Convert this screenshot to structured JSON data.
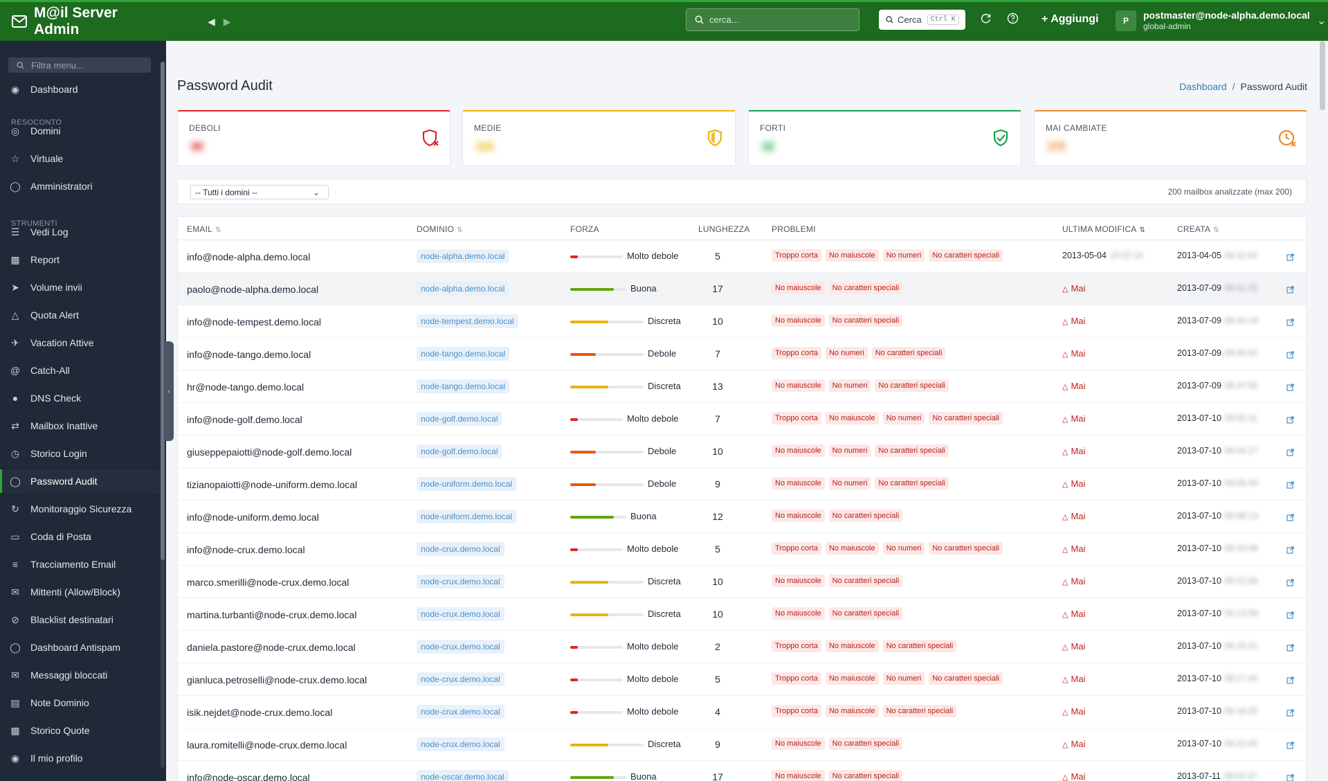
{
  "app": {
    "title": "M@il Server Admin"
  },
  "topbar": {
    "search_placeholder": "cerca...",
    "cmdk_label": "Cerca",
    "cmdk_kbd": "Ctrl K",
    "add_label": "+ Aggiungi",
    "user_initial": "P",
    "user_email": "postmaster@node-alpha.demo.local",
    "user_role": "global-admin"
  },
  "sidebar": {
    "filter_placeholder": "Filtra menu...",
    "section_resoconto": "RESOCONTO",
    "section_strumenti": "STRUMENTI",
    "items": [
      {
        "label": "Dashboard",
        "icon": "dashboard-icon"
      },
      {
        "label": "Domini",
        "icon": "globe-icon"
      },
      {
        "label": "Virtuale",
        "icon": "users-icon"
      },
      {
        "label": "Amministratori",
        "icon": "shield-icon"
      },
      {
        "label": "Vedi Log",
        "icon": "list-icon"
      },
      {
        "label": "Report",
        "icon": "chart-icon"
      },
      {
        "label": "Volume invii",
        "icon": "send-icon"
      },
      {
        "label": "Quota Alert",
        "icon": "warning-icon"
      },
      {
        "label": "Vacation Attive",
        "icon": "plane-icon"
      },
      {
        "label": "Catch-All",
        "icon": "at-icon"
      },
      {
        "label": "DNS Check",
        "icon": "user-icon"
      },
      {
        "label": "Mailbox Inattive",
        "icon": "swap-icon"
      },
      {
        "label": "Storico Login",
        "icon": "history-icon"
      },
      {
        "label": "Password Audit",
        "icon": "shield-check-icon",
        "active": true
      },
      {
        "label": "Monitoraggio Sicurezza",
        "icon": "refresh-icon"
      },
      {
        "label": "Coda di Posta",
        "icon": "inbox-icon"
      },
      {
        "label": "Tracciamento Email",
        "icon": "filter-icon"
      },
      {
        "label": "Mittenti (Allow/Block)",
        "icon": "mail-icon"
      },
      {
        "label": "Blacklist destinatari",
        "icon": "ban-icon"
      },
      {
        "label": "Dashboard Antispam",
        "icon": "shield-icon"
      },
      {
        "label": "Messaggi bloccati",
        "icon": "blocked-mail-icon"
      },
      {
        "label": "Note Dominio",
        "icon": "note-icon"
      },
      {
        "label": "Storico Quote",
        "icon": "chart-icon"
      },
      {
        "label": "Il mio profilo",
        "icon": "user-circle-icon"
      }
    ]
  },
  "page": {
    "title": "Password Audit",
    "breadcrumb_home": "Dashboard",
    "breadcrumb_current": "Password Audit"
  },
  "stats": [
    {
      "label": "DEBOLI",
      "value": "96",
      "color": "#dc2626"
    },
    {
      "label": "MEDIE",
      "value": "122",
      "color": "#eab308"
    },
    {
      "label": "FORTI",
      "value": "12",
      "color": "#16a34a"
    },
    {
      "label": "MAI CAMBIATE",
      "value": "173",
      "color": "#ea8a2e"
    }
  ],
  "filter": {
    "domain_selected": "-- Tutti i domini --",
    "info": "200 mailbox analizzate (max 200)"
  },
  "table": {
    "headers": {
      "email": "EMAIL",
      "domain": "DOMINIO",
      "strength": "FORZA",
      "length": "LUNGHEZZA",
      "problems": "PROBLEMI",
      "modified": "ULTIMA MODIFICA",
      "created": "CREATA"
    },
    "rows": [
      {
        "email": "info@node-alpha.demo.local",
        "domain": "node-alpha.demo.local",
        "strength": "Molto debole",
        "level": 0.1,
        "length": "5",
        "problems": [
          "Troppo corta",
          "No maiuscole",
          "No numeri",
          "No caratteri speciali"
        ],
        "modified": "2013-05-04",
        "modified_time": "10:22:14",
        "created": "2013-04-05",
        "created_time": "09:11:02"
      },
      {
        "email": "paolo@node-alpha.demo.local",
        "domain": "node-alpha.demo.local",
        "strength": "Buona",
        "level": 0.78,
        "length": "17",
        "problems": [
          "No maiuscole",
          "No caratteri speciali"
        ],
        "modified": "Mai",
        "created": "2013-07-09",
        "created_time": "08:41:33"
      },
      {
        "email": "info@node-tempest.demo.local",
        "domain": "node-tempest.demo.local",
        "strength": "Discreta",
        "level": 0.52,
        "length": "10",
        "problems": [
          "No maiuscole",
          "No caratteri speciali"
        ],
        "modified": "Mai",
        "created": "2013-07-09",
        "created_time": "08:43:19"
      },
      {
        "email": "info@node-tango.demo.local",
        "domain": "node-tango.demo.local",
        "strength": "Debole",
        "level": 0.35,
        "length": "7",
        "problems": [
          "Troppo corta",
          "No numeri",
          "No caratteri speciali"
        ],
        "modified": "Mai",
        "created": "2013-07-09",
        "created_time": "08:45:02"
      },
      {
        "email": "hr@node-tango.demo.local",
        "domain": "node-tango.demo.local",
        "strength": "Discreta",
        "level": 0.52,
        "length": "13",
        "problems": [
          "No maiuscole",
          "No numeri",
          "No caratteri speciali"
        ],
        "modified": "Mai",
        "created": "2013-07-09",
        "created_time": "08:47:55"
      },
      {
        "email": "info@node-golf.demo.local",
        "domain": "node-golf.demo.local",
        "strength": "Molto debole",
        "level": 0.1,
        "length": "7",
        "problems": [
          "Troppo corta",
          "No maiuscole",
          "No numeri",
          "No caratteri speciali"
        ],
        "modified": "Mai",
        "created": "2013-07-10",
        "created_time": "09:02:11"
      },
      {
        "email": "giuseppepaiotti@node-golf.demo.local",
        "domain": "node-golf.demo.local",
        "strength": "Debole",
        "level": 0.35,
        "length": "10",
        "problems": [
          "No maiuscole",
          "No numeri",
          "No caratteri speciali"
        ],
        "modified": "Mai",
        "created": "2013-07-10",
        "created_time": "09:04:27"
      },
      {
        "email": "tizianopaiotti@node-uniform.demo.local",
        "domain": "node-uniform.demo.local",
        "strength": "Debole",
        "level": 0.35,
        "length": "9",
        "problems": [
          "No maiuscole",
          "No numeri",
          "No caratteri speciali"
        ],
        "modified": "Mai",
        "created": "2013-07-10",
        "created_time": "09:06:40"
      },
      {
        "email": "info@node-uniform.demo.local",
        "domain": "node-uniform.demo.local",
        "strength": "Buona",
        "level": 0.78,
        "length": "12",
        "problems": [
          "No maiuscole",
          "No caratteri speciali"
        ],
        "modified": "Mai",
        "created": "2013-07-10",
        "created_time": "09:08:13"
      },
      {
        "email": "info@node-crux.demo.local",
        "domain": "node-crux.demo.local",
        "strength": "Molto debole",
        "level": 0.1,
        "length": "5",
        "problems": [
          "Troppo corta",
          "No maiuscole",
          "No numeri",
          "No caratteri speciali"
        ],
        "modified": "Mai",
        "created": "2013-07-10",
        "created_time": "09:10:48"
      },
      {
        "email": "marco.smerilli@node-crux.demo.local",
        "domain": "node-crux.demo.local",
        "strength": "Discreta",
        "level": 0.52,
        "length": "10",
        "problems": [
          "No maiuscole",
          "No caratteri speciali"
        ],
        "modified": "Mai",
        "created": "2013-07-10",
        "created_time": "09:12:06"
      },
      {
        "email": "martina.turbanti@node-crux.demo.local",
        "domain": "node-crux.demo.local",
        "strength": "Discreta",
        "level": 0.52,
        "length": "10",
        "problems": [
          "No maiuscole",
          "No caratteri speciali"
        ],
        "modified": "Mai",
        "created": "2013-07-10",
        "created_time": "09:13:59"
      },
      {
        "email": "daniela.pastore@node-crux.demo.local",
        "domain": "node-crux.demo.local",
        "strength": "Molto debole",
        "level": 0.1,
        "length": "2",
        "problems": [
          "Troppo corta",
          "No maiuscole",
          "No caratteri speciali"
        ],
        "modified": "Mai",
        "created": "2013-07-10",
        "created_time": "09:15:31"
      },
      {
        "email": "gianluca.petroselli@node-crux.demo.local",
        "domain": "node-crux.demo.local",
        "strength": "Molto debole",
        "level": 0.1,
        "length": "5",
        "problems": [
          "Troppo corta",
          "No maiuscole",
          "No numeri",
          "No caratteri speciali"
        ],
        "modified": "Mai",
        "created": "2013-07-10",
        "created_time": "09:17:44"
      },
      {
        "email": "isik.nejdet@node-crux.demo.local",
        "domain": "node-crux.demo.local",
        "strength": "Molto debole",
        "level": 0.1,
        "length": "4",
        "problems": [
          "Troppo corta",
          "No maiuscole",
          "No caratteri speciali"
        ],
        "modified": "Mai",
        "created": "2013-07-10",
        "created_time": "09:19:20"
      },
      {
        "email": "laura.romitelli@node-crux.demo.local",
        "domain": "node-crux.demo.local",
        "strength": "Discreta",
        "level": 0.52,
        "length": "9",
        "problems": [
          "No maiuscole",
          "No caratteri speciali"
        ],
        "modified": "Mai",
        "created": "2013-07-10",
        "created_time": "09:21:05"
      },
      {
        "email": "info@node-oscar.demo.local",
        "domain": "node-oscar.demo.local",
        "strength": "Buona",
        "level": 0.78,
        "length": "17",
        "problems": [
          "No maiuscole",
          "No caratteri speciali"
        ],
        "modified": "Mai",
        "created": "2013-07-11",
        "created_time": "08:02:37"
      }
    ]
  },
  "colors": {
    "topbar": "#1c6b1f",
    "accent": "#2fa83a",
    "sidebar": "#1f2937",
    "very_weak": "#dc2626",
    "weak": "#ea580c",
    "fair": "#eab308",
    "good": "#65a30d"
  }
}
